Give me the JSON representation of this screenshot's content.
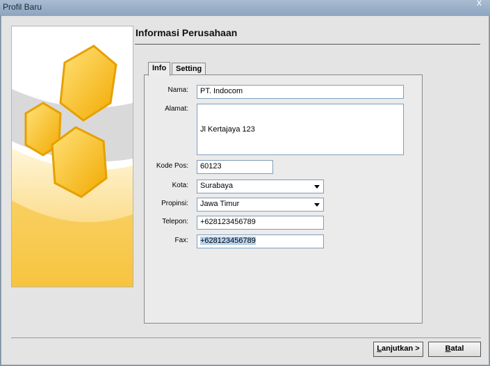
{
  "window": {
    "title": "Profil Baru",
    "close_glyph": "x"
  },
  "header": {
    "title": "Informasi Perusahaan"
  },
  "tabs": [
    {
      "label": "Info",
      "active": true
    },
    {
      "label": "Setting",
      "active": false
    }
  ],
  "form": {
    "nama": {
      "label": "Nama:",
      "value": "PT. Indocom"
    },
    "alamat": {
      "label": "Alamat:",
      "value": "Jl Kertajaya 123"
    },
    "kode_pos": {
      "label": "Kode Pos:",
      "value": "60123"
    },
    "kota": {
      "label": "Kota:",
      "value": "Surabaya"
    },
    "propinsi": {
      "label": "Propinsi:",
      "value": "Jawa Timur"
    },
    "telepon": {
      "label": "Telepon:",
      "value": "+628123456789"
    },
    "fax": {
      "label": "Fax:",
      "value": "+628123456789"
    }
  },
  "buttons": {
    "next": {
      "label_u": "L",
      "label_rest": "anjutkan >"
    },
    "cancel": {
      "label_u": "B",
      "label_rest": "atal"
    }
  },
  "colors": {
    "accent_gold": "#f6b820",
    "panel_bg": "#e4e4e4",
    "field_border": "#7f9db9",
    "selection": "#b6d2f0"
  },
  "icons": {
    "side_graphic": "hexagon-logo"
  }
}
